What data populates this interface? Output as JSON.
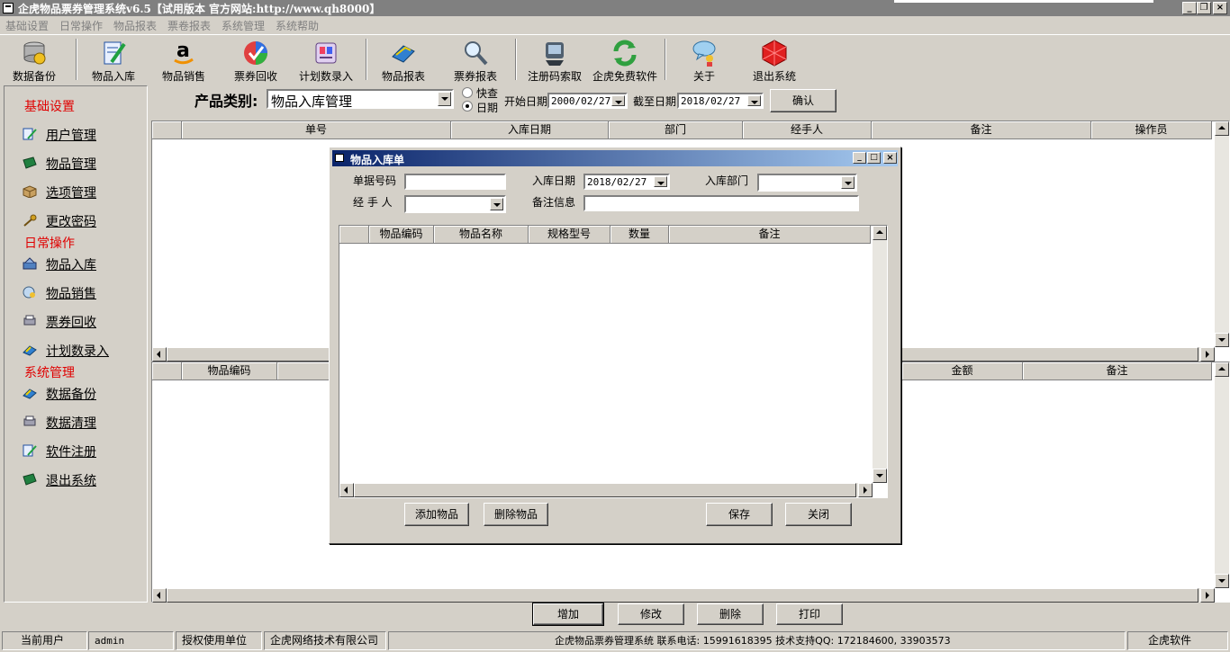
{
  "window": {
    "title": "企虎物品票券管理系统v6.5【试用版本 官方网站:http://www.qh8000】",
    "minimize": "_",
    "restore": "❐",
    "close": "×"
  },
  "menu": [
    "基础设置",
    "日常操作",
    "物品报表",
    "票卷报表",
    "系统管理",
    "系统帮助"
  ],
  "toolbar": [
    {
      "label": "数据备份",
      "icon": "database-backup-icon"
    },
    {
      "label": "物品入库",
      "icon": "stock-in-icon"
    },
    {
      "label": "物品销售",
      "icon": "amazon-sales-icon"
    },
    {
      "label": "票券回收",
      "icon": "ticket-recycle-icon"
    },
    {
      "label": "计划数录入",
      "icon": "plan-entry-icon"
    },
    {
      "label": "物品报表",
      "icon": "item-report-icon"
    },
    {
      "label": "票券报表",
      "icon": "ticket-report-icon"
    },
    {
      "label": "注册码索取",
      "icon": "register-code-icon"
    },
    {
      "label": "企虎免费软件",
      "icon": "free-software-icon"
    },
    {
      "label": "关于",
      "icon": "about-icon"
    },
    {
      "label": "退出系统",
      "icon": "exit-icon"
    }
  ],
  "sidebar": {
    "groups": [
      {
        "title": "基础设置",
        "items": [
          "用户管理",
          "物品管理",
          "选项管理",
          "更改密码"
        ]
      },
      {
        "title": "日常操作",
        "items": [
          "物品入库",
          "物品销售",
          "票券回收",
          "计划数录入"
        ]
      },
      {
        "title": "系统管理",
        "items": [
          "数据备份",
          "数据清理",
          "软件注册",
          "退出系统"
        ]
      }
    ]
  },
  "filter": {
    "category_label": "产品类别:",
    "category_value": "物品入库管理",
    "radio_quick": "快查",
    "radio_date": "日期",
    "start_label": "开始日期",
    "start_value": "2000/02/27",
    "end_label": "截至日期",
    "end_value": "2018/02/27",
    "confirm": "确认"
  },
  "top_grid": {
    "columns": [
      "",
      "单号",
      "入库日期",
      "部门",
      "经手人",
      "备注",
      "操作员"
    ]
  },
  "bottom_grid": {
    "columns": [
      "",
      "物品编码",
      "金额",
      "备注"
    ]
  },
  "dialog": {
    "title": "物品入库单",
    "doc_no_label": "单据号码",
    "doc_no_value": "",
    "date_label": "入库日期",
    "date_value": "2018/02/27",
    "dept_label": "入库部门",
    "dept_value": "",
    "handler_label": "经 手 人",
    "handler_value": "",
    "note_label": "备注信息",
    "note_value": "",
    "grid_columns": [
      "",
      "物品编码",
      "物品名称",
      "规格型号",
      "数量",
      "备注"
    ],
    "add_item": "添加物品",
    "delete_item": "删除物品",
    "save": "保存",
    "close": "关闭"
  },
  "actions": {
    "add": "增加",
    "edit": "修改",
    "delete": "删除",
    "print": "打印"
  },
  "status": {
    "current_user_label": "当前用户",
    "current_user": "admin",
    "licensee_label": "授权使用单位",
    "licensee": "企虎网络技术有限公司",
    "info": "企虎物品票券管理系统  联系电话: 15991618395  技术支持QQ: 172184600, 33903573",
    "brand": "企虎软件"
  }
}
